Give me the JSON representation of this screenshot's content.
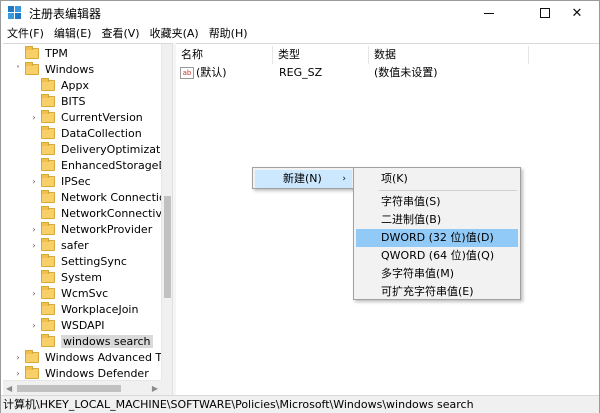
{
  "window": {
    "title": "注册表编辑器",
    "icon": "registry-editor-icon"
  },
  "menubar": {
    "items": [
      "文件(F)",
      "编辑(E)",
      "查看(V)",
      "收藏夹(A)",
      "帮助(H)"
    ]
  },
  "tree": {
    "items": [
      {
        "label": "TPM",
        "expander": "",
        "selected": false
      },
      {
        "label": "Windows",
        "expander": "˅",
        "selected": false
      },
      {
        "label": "Appx",
        "expander": "",
        "selected": false
      },
      {
        "label": "BITS",
        "expander": "",
        "selected": false
      },
      {
        "label": "CurrentVersion",
        "expander": "›",
        "selected": false
      },
      {
        "label": "DataCollection",
        "expander": "",
        "selected": false
      },
      {
        "label": "DeliveryOptimization",
        "expander": "",
        "selected": false
      },
      {
        "label": "EnhancedStorageDev",
        "expander": "",
        "selected": false
      },
      {
        "label": "IPSec",
        "expander": "›",
        "selected": false
      },
      {
        "label": "Network Connections",
        "expander": "",
        "selected": false
      },
      {
        "label": "NetworkConnectivityS",
        "expander": "",
        "selected": false
      },
      {
        "label": "NetworkProvider",
        "expander": "›",
        "selected": false
      },
      {
        "label": "safer",
        "expander": "›",
        "selected": false
      },
      {
        "label": "SettingSync",
        "expander": "",
        "selected": false
      },
      {
        "label": "System",
        "expander": "",
        "selected": false
      },
      {
        "label": "WcmSvc",
        "expander": "›",
        "selected": false
      },
      {
        "label": "WorkplaceJoin",
        "expander": "",
        "selected": false
      },
      {
        "label": "WSDAPI",
        "expander": "›",
        "selected": false
      },
      {
        "label": "windows search",
        "expander": "",
        "selected": true
      },
      {
        "label": "Windows Advanced Thre",
        "expander": "›",
        "selected": false
      },
      {
        "label": "Windows Defender",
        "expander": "›",
        "selected": false
      }
    ]
  },
  "list": {
    "columns": [
      "名称",
      "类型",
      "数据"
    ],
    "rows": [
      {
        "name": "(默认)",
        "type": "REG_SZ",
        "data": "(数值未设置)",
        "icon": "ab"
      }
    ]
  },
  "context_menu": {
    "new_label": "新建(N)",
    "arrow": "›",
    "submenu": {
      "key": "项(K)",
      "items": [
        {
          "label": "字符串值(S)",
          "highlighted": false
        },
        {
          "label": "二进制值(B)",
          "highlighted": false
        },
        {
          "label": "DWORD (32 位)值(D)",
          "highlighted": true
        },
        {
          "label": "QWORD (64 位)值(Q)",
          "highlighted": false
        },
        {
          "label": "多字符串值(M)",
          "highlighted": false
        },
        {
          "label": "可扩充字符串值(E)",
          "highlighted": false
        }
      ]
    }
  },
  "statusbar": {
    "path": "计算机\\HKEY_LOCAL_MACHINE\\SOFTWARE\\Policies\\Microsoft\\Windows\\windows search"
  },
  "colors": {
    "highlight": "#91c9f7",
    "menu_hover": "#cce8ff",
    "folder": "#f7d069",
    "selected_tree": "#d9d9d9"
  }
}
